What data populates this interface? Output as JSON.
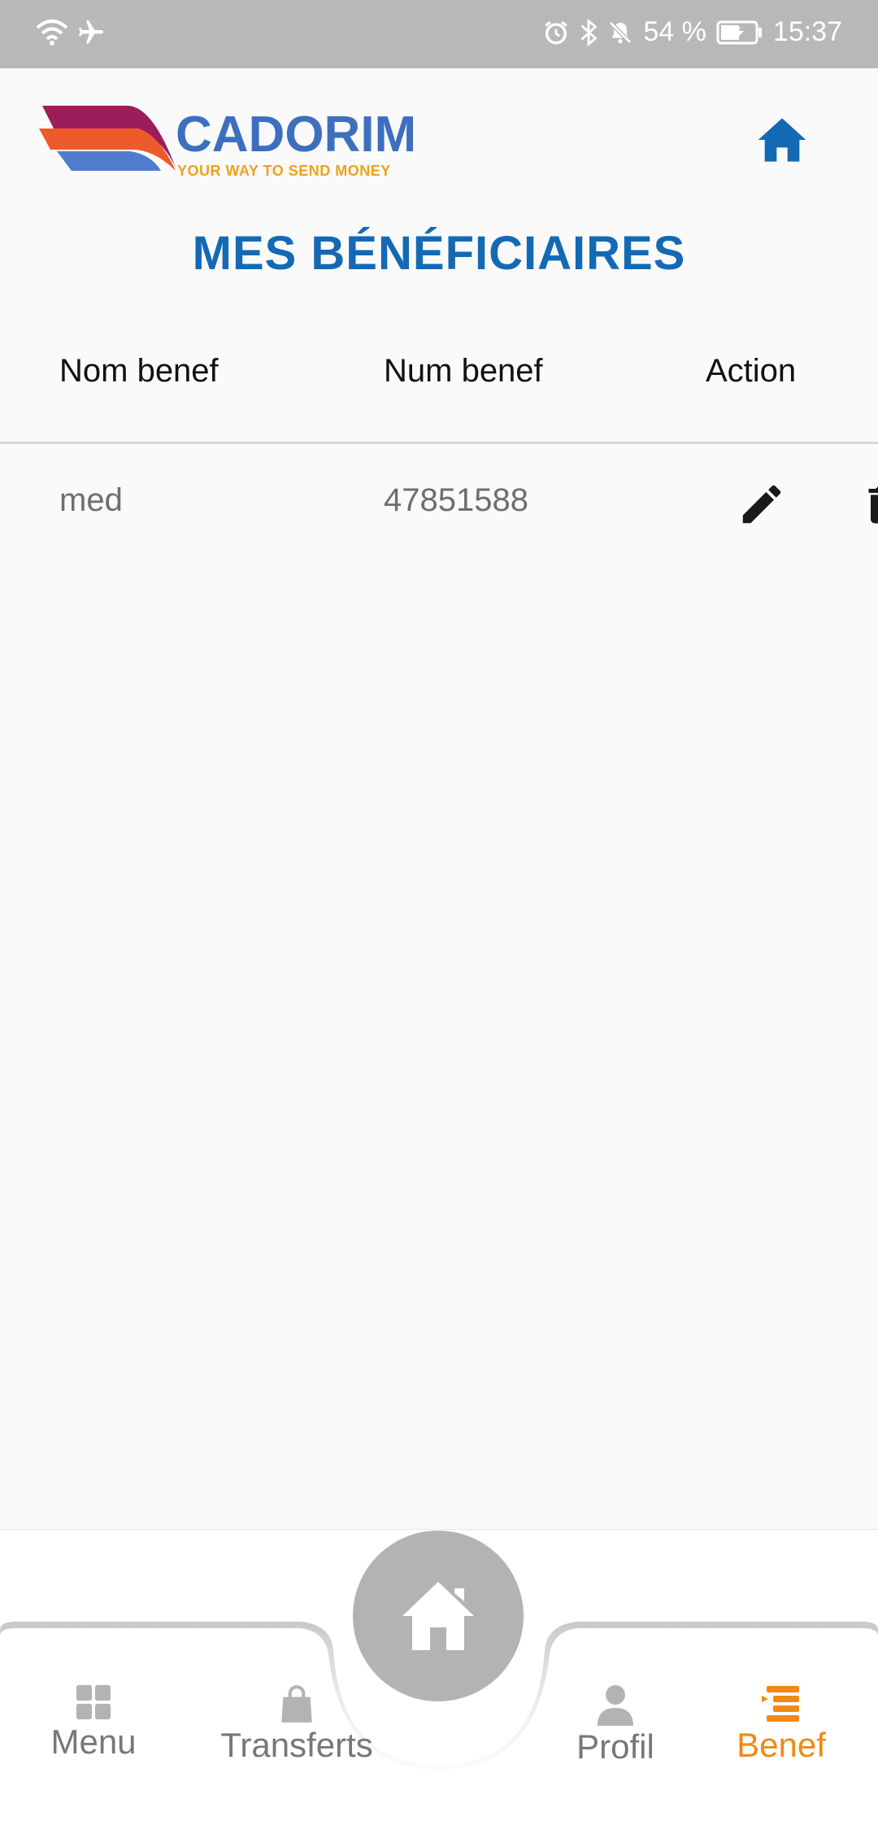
{
  "status_bar": {
    "battery": "54 %",
    "time": "15:37"
  },
  "header": {
    "logo_word": "CADORIM",
    "logo_tagline": "YOUR WAY TO SEND MONEY"
  },
  "page": {
    "title": "MES BÉNÉFICIAIRES"
  },
  "table": {
    "columns": [
      "Nom benef",
      "Num benef",
      "Action"
    ],
    "rows": [
      {
        "name": "med",
        "number": "47851588"
      }
    ]
  },
  "bottom_nav": {
    "items": [
      {
        "label": "Menu",
        "icon": "grid-icon"
      },
      {
        "label": "Transferts",
        "icon": "shopping-bag-icon"
      },
      {
        "label": "Profil",
        "icon": "person-icon"
      },
      {
        "label": "Benef",
        "icon": "list-icon",
        "active": true
      }
    ],
    "center_button_icon": "home-icon"
  },
  "colors": {
    "title_blue": "#1469b4",
    "active_orange": "#f08a14",
    "status_bar_bg": "#b8b8b8",
    "fab_gray": "#b3b3b3"
  }
}
